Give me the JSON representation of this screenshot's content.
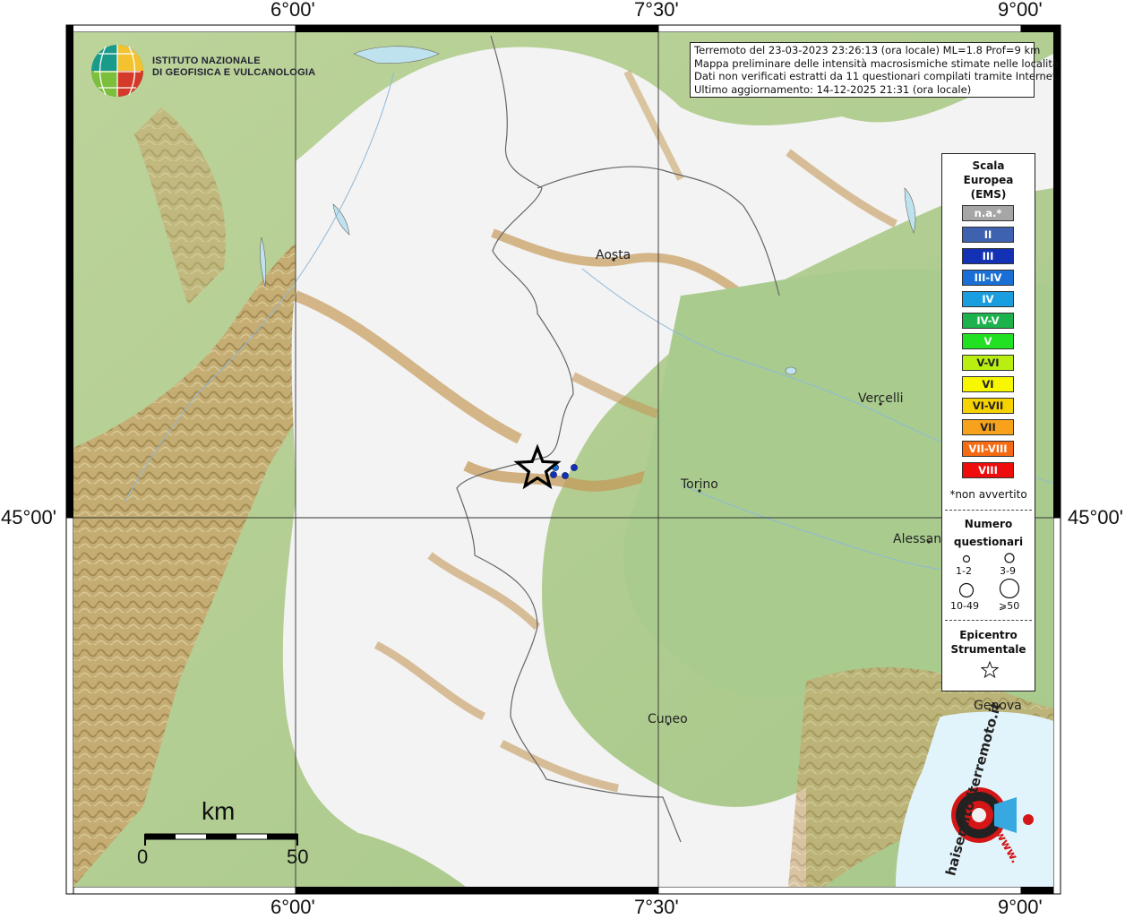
{
  "header": {
    "institute_line1": "ISTITUTO NAZIONALE",
    "institute_line2": "DI GEOFISICA E VULCANOLOGIA"
  },
  "info": {
    "line1": "Terremoto del 23-03-2023 23:26:13 (ora locale) ML=1.8 Prof=9 km",
    "line2": "Mappa preliminare delle intensità macrosismiche stimate nelle località",
    "line3": "Dati non verificati estratti da 11 questionari compilati tramite Internet.",
    "line4": "Ultimo aggiornamento: 14-12-2025 21:31 (ora locale)"
  },
  "coords": {
    "lon_left": "6°00'",
    "lon_mid": "7°30'",
    "lon_right": "9°00'",
    "lat": "45°00'"
  },
  "cities": {
    "aosta": "Aosta",
    "vercelli": "Vercelli",
    "torino": "Torino",
    "alessandria": "Alessan",
    "cuneo": "Cuneo",
    "genova": "Genova"
  },
  "legend": {
    "title1": "Scala",
    "title2": "Europea",
    "title3": "(EMS)",
    "levels": [
      {
        "label": "n.a.*",
        "color": "#a6a6a6"
      },
      {
        "label": "II",
        "color": "#3f62b0"
      },
      {
        "label": "III",
        "color": "#1231b5"
      },
      {
        "label": "III-IV",
        "color": "#1a6fd6"
      },
      {
        "label": "IV",
        "color": "#1a9ee0"
      },
      {
        "label": "IV-V",
        "color": "#1db34c"
      },
      {
        "label": "V",
        "color": "#22e022"
      },
      {
        "label": "V-VI",
        "color": "#b8ef10"
      },
      {
        "label": "VI",
        "color": "#f7f700"
      },
      {
        "label": "VI-VII",
        "color": "#f6d200"
      },
      {
        "label": "VII",
        "color": "#f7a21a"
      },
      {
        "label": "VII-VIII",
        "color": "#f56a12"
      },
      {
        "label": "VIII",
        "color": "#ef0c0c"
      }
    ],
    "not_felt": "*non avvertito",
    "count_title1": "Numero",
    "count_title2": "questionari",
    "sizes": {
      "s1": "1-2",
      "s2": "3-9",
      "s3": "10-49",
      "s4": "⩾50"
    },
    "epi1": "Epicentro",
    "epi2": "Strumentale"
  },
  "scalebar": {
    "unit": "km",
    "zero": "0",
    "end": "50"
  },
  "branding": {
    "site": "haisentitoilterremoto.it",
    "www": "www."
  },
  "observations": [
    {
      "intensity": "III",
      "color": "#1231b5"
    },
    {
      "intensity": "III",
      "color": "#1231b5"
    },
    {
      "intensity": "III-IV",
      "color": "#1a6fd6"
    },
    {
      "intensity": "III",
      "color": "#1231b5"
    }
  ]
}
